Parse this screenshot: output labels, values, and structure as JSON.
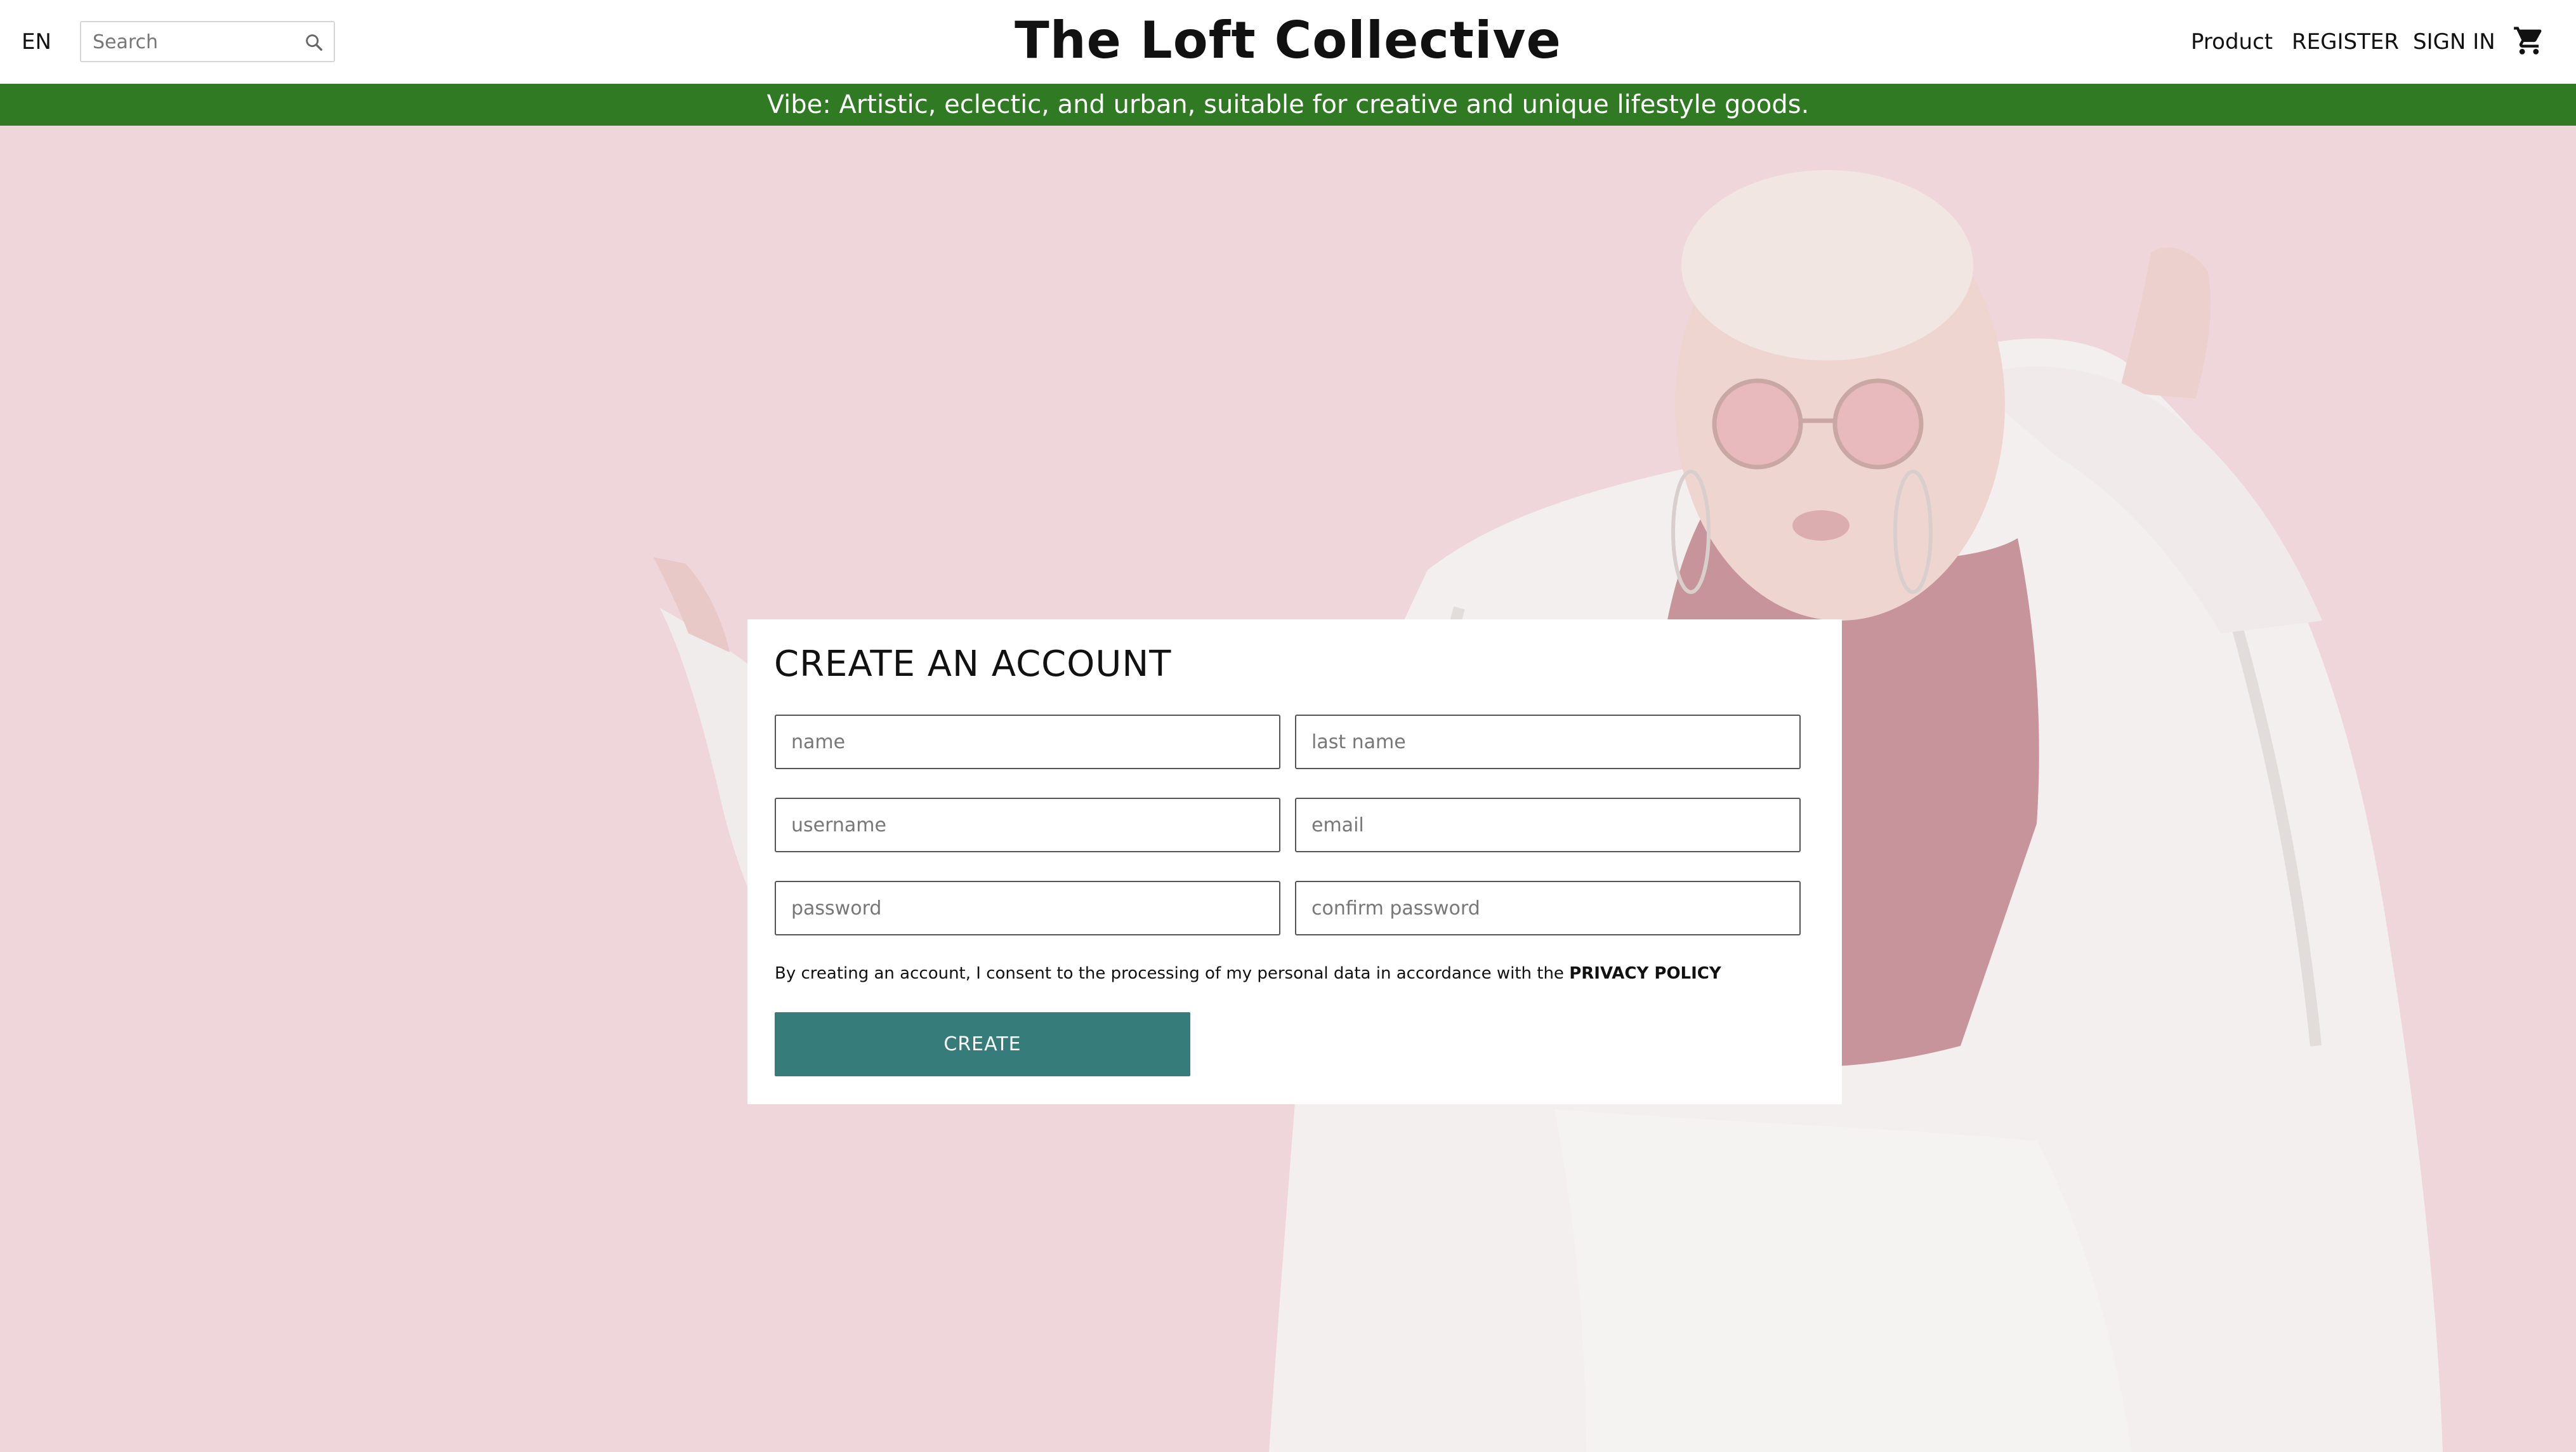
{
  "header": {
    "language": "EN",
    "search_placeholder": "Search",
    "brand": "The Loft Collective",
    "nav": {
      "product": "Product",
      "register": "REGISTER",
      "sign_in": "SIGN IN"
    },
    "icons": {
      "search": "search-icon",
      "cart": "cart-icon"
    }
  },
  "banner": {
    "text": "Vibe: Artistic, eclectic, and urban, suitable for creative and unique lifestyle goods."
  },
  "form": {
    "title": "CREATE AN ACCOUNT",
    "fields": {
      "name": "name",
      "last_name": "last name",
      "username": "username",
      "email": "email",
      "password": "password",
      "confirm_password": "confirm password"
    },
    "consent_text": "By creating an account, I consent to the processing of my personal data in accordance with the ",
    "privacy_link": "PRIVACY POLICY",
    "submit_label": "CREATE"
  },
  "colors": {
    "banner_bg": "#2f7a22",
    "hero_bg": "#eed6db",
    "button_bg": "#367c7b"
  }
}
